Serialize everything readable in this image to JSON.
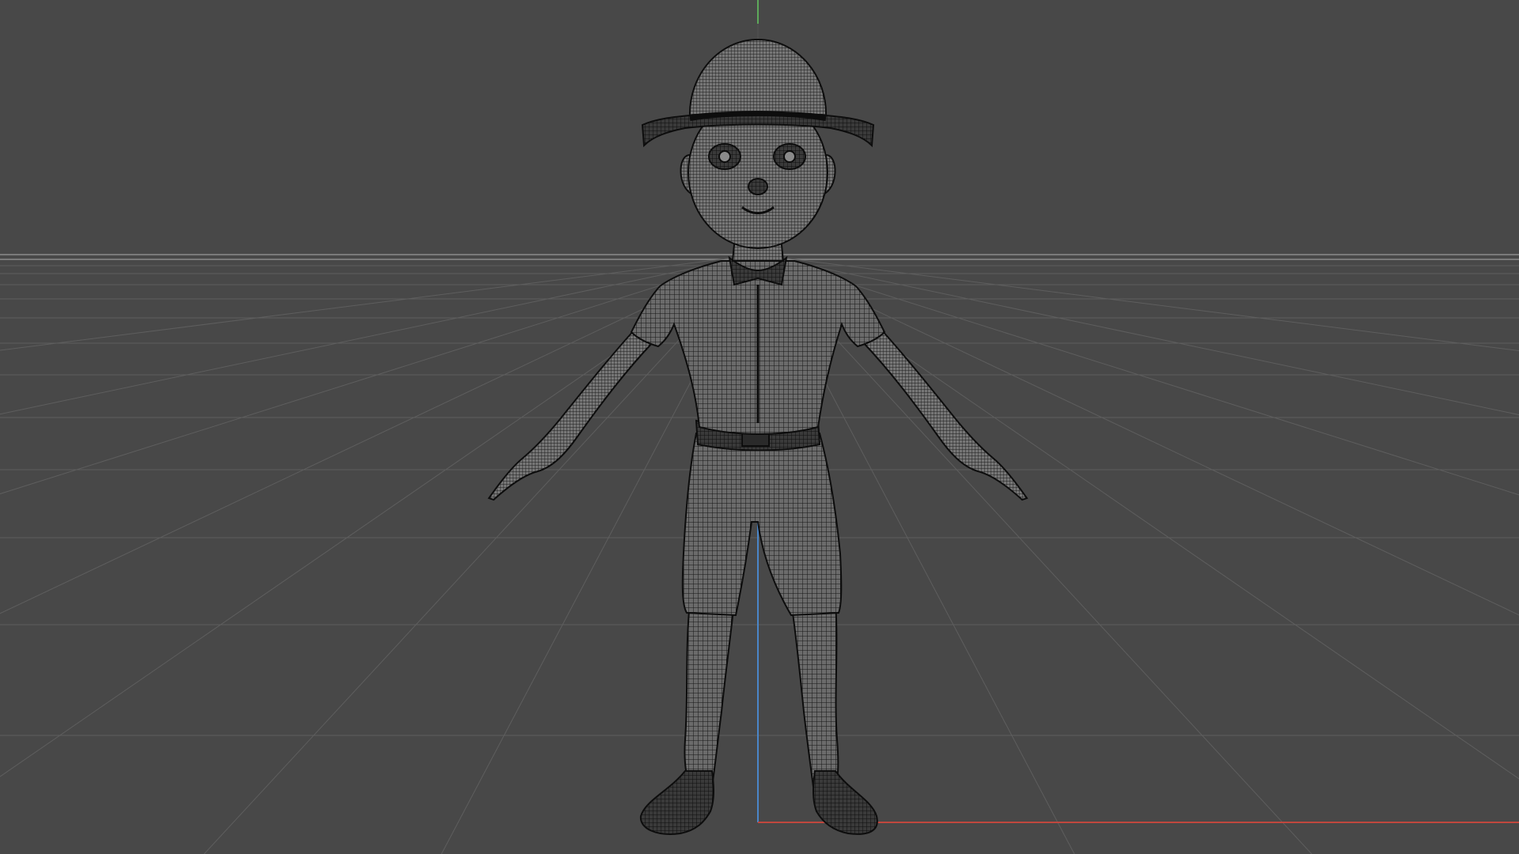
{
  "viewport": {
    "view": "front",
    "shading": "wireframe-on-shaded",
    "grid_visible": true,
    "axes_visible": [
      "x",
      "y",
      "z"
    ],
    "subject": "character-model-boy-t-pose",
    "colors": {
      "background": "#484848",
      "grid_line": "#5e5e5e",
      "horizon_line": "#8a8a8a",
      "x_axis": "#c0473e",
      "y_axis": "#5da95a",
      "z_axis": "#4a86c8",
      "mesh_fill": "#6b6b6b",
      "mesh_wire": "#161616",
      "mesh_outline": "#0d0d0d"
    }
  }
}
